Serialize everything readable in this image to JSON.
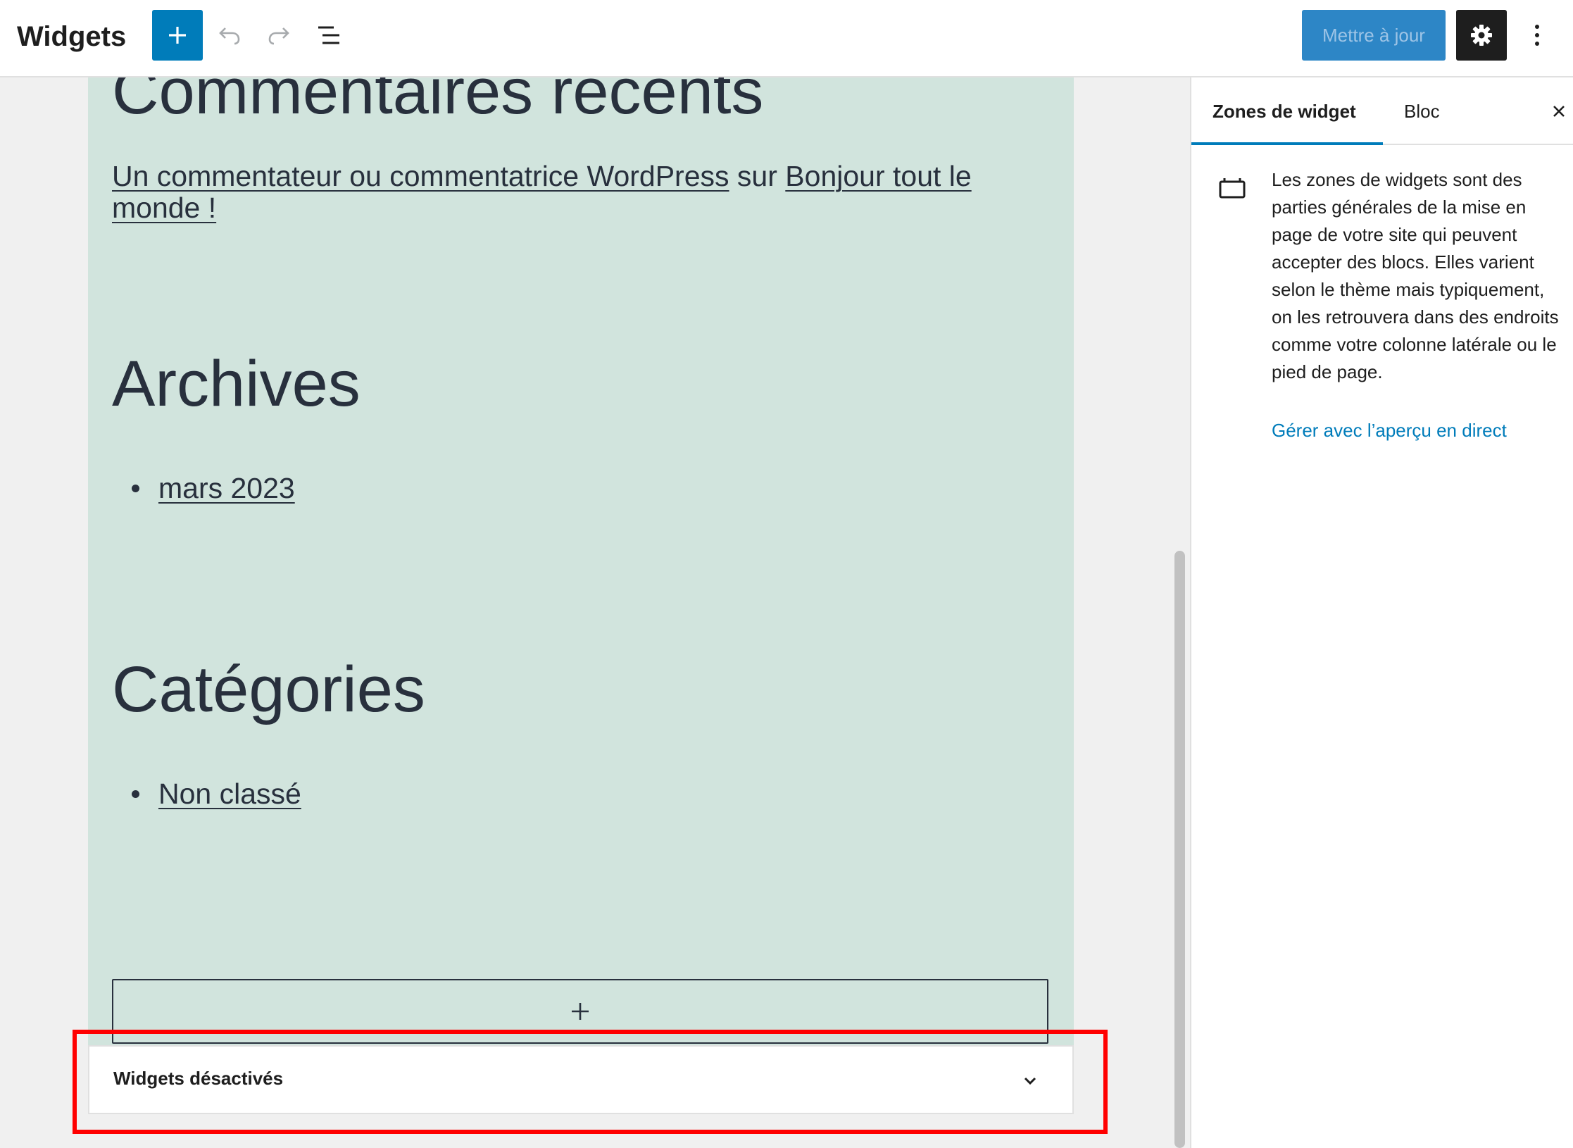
{
  "toolbar": {
    "title": "Widgets",
    "add_icon": "plus-icon",
    "undo_icon": "undo-icon",
    "redo_icon": "redo-icon",
    "list_view_icon": "list-view-icon",
    "update_label": "Mettre à jour",
    "settings_icon": "gear-icon",
    "more_icon": "more-vertical-icon"
  },
  "widget_area": {
    "recent_comments_heading": "Commentaires récents",
    "comment_author": "Un commentateur ou commentatrice WordPress",
    "comment_on": "sur",
    "comment_post": "Bonjour tout le monde !",
    "archives_heading": "Archives",
    "archives_items": [
      "mars 2023"
    ],
    "categories_heading": "Catégories",
    "categories_items": [
      "Non classé"
    ],
    "appender_icon": "plus-icon"
  },
  "inactive_widgets": {
    "label": "Widgets désactivés",
    "chevron_icon": "chevron-down-icon",
    "highlight_color": "#ff0000"
  },
  "sidebar": {
    "tabs": [
      {
        "label": "Zones de widget",
        "active": true
      },
      {
        "label": "Bloc",
        "active": false
      }
    ],
    "close_icon": "close-icon",
    "widget_icon": "widget-area-icon",
    "description": "Les zones de widgets sont des parties générales de la mise en page de votre site qui peuvent accepter des blocs. Elles varient selon le thème mais typiquement, on les retrouvera dans des endroits comme votre colonne latérale ou le pied de page.",
    "link_label": "Gérer avec l’aperçu en direct"
  },
  "colors": {
    "accent": "#007cba",
    "widget_area_bg": "#d1e4dd",
    "text_dark": "#28303d"
  }
}
